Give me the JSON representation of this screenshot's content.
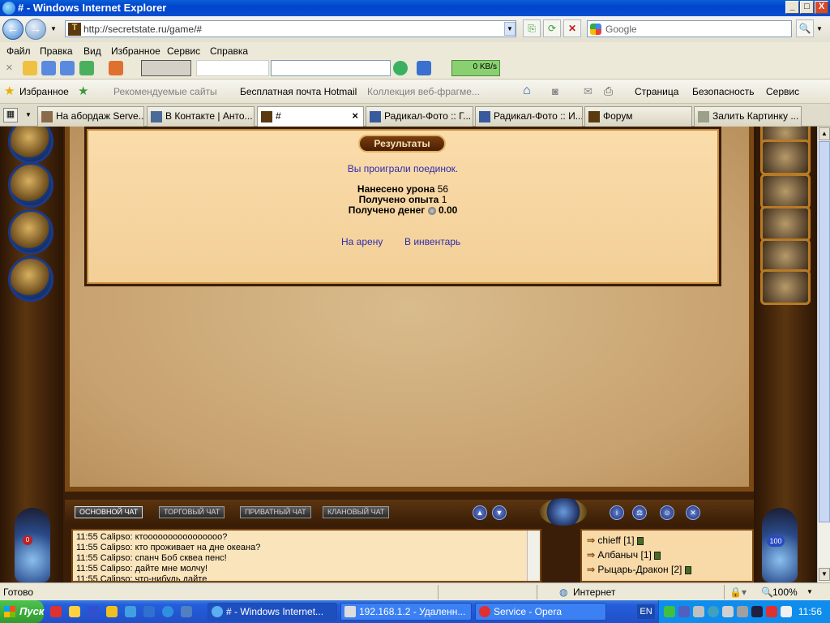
{
  "window": {
    "title": "# - Windows Internet Explorer",
    "controls": {
      "minimize": "_",
      "maximize": "□",
      "close": "X"
    }
  },
  "addressbar": {
    "url": "http://secretstate.ru/game/#",
    "search_placeholder": "Google"
  },
  "menu": [
    "Файл",
    "Правка",
    "Вид",
    "Избранное",
    "Сервис",
    "Справка"
  ],
  "toolbar": {
    "speed": "0 KB/s"
  },
  "favorites": {
    "label": "Избранное",
    "items": [
      "Рекомендуемые сайты",
      "Бесплатная почта Hotmail",
      "Коллекция веб-фрагме..."
    ],
    "right": [
      "Страница",
      "Безопасность",
      "Сервис"
    ]
  },
  "tabs": [
    {
      "label": "На абордаж Serve..."
    },
    {
      "label": "В Контакте | Анто..."
    },
    {
      "label": "#",
      "close": "×"
    },
    {
      "label": "Радикал-Фото :: Г..."
    },
    {
      "label": "Радикал-Фото :: И..."
    },
    {
      "label": "Форум"
    },
    {
      "label": "Залить Картинку ..."
    }
  ],
  "game": {
    "results_button": "Результаты",
    "lost_message": "Вы проиграли поединок.",
    "damage_label": "Нанесено урона",
    "damage_value": "56",
    "exp_label": "Получено опыта",
    "exp_value": "1",
    "money_label": "Получено денег",
    "money_value": "0.00",
    "link_arena": "На арену",
    "link_inventory": "В инвентарь",
    "chat_tabs": [
      "ОСНОВНОЙ ЧАТ",
      "ТОРГОВЫЙ ЧАТ",
      "ПРИВАТНЫЙ ЧАТ",
      "КЛАНОВЫЙ ЧАТ"
    ],
    "chat_lines": [
      "11:55 Calipso: ктоооооооооооооооо?",
      "11:55 Calipso: кто проживает на дне океана?",
      "11:55 Calipso: спанч Боб сквеа пенс!",
      "11:55 Calipso: дайте мне молчу!",
      "11:55 Calipso: что-нибудь дайте"
    ],
    "users": [
      {
        "name": "chieff",
        "level": "[1]"
      },
      {
        "name": "Албаныч",
        "level": "[1]"
      },
      {
        "name": "Рыцарь-Дракон",
        "level": "[2]"
      }
    ],
    "flask_left": "0",
    "flask_right": "100"
  },
  "statusbar": {
    "left": "Готово",
    "zone": "Интернет",
    "zoom": "100%"
  },
  "taskbar": {
    "start": "Пуск",
    "buttons": [
      "# - Windows Internet...",
      "192.168.1.2 - Удаленн...",
      "Service - Opera"
    ],
    "lang": "EN",
    "clock": "11:56"
  }
}
